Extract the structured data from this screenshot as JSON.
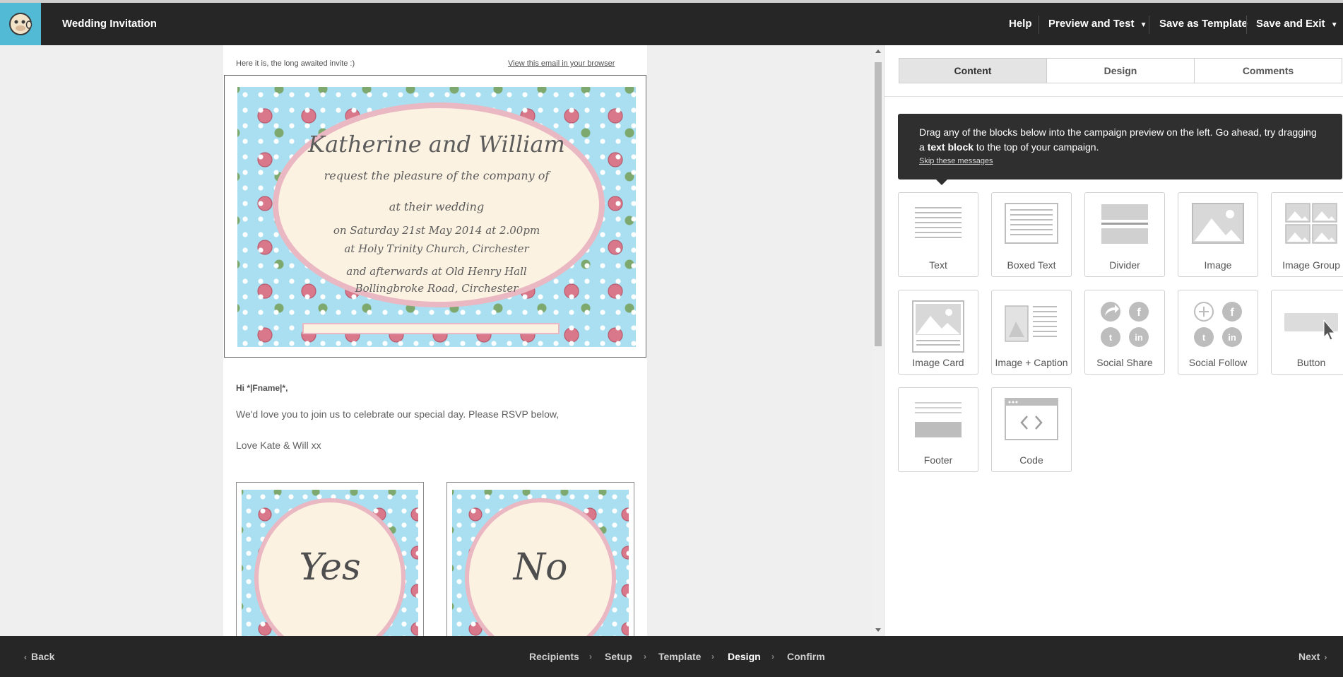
{
  "app": {
    "title": "Wedding Invitation",
    "logo_icon": "chimp-logo-icon"
  },
  "topbar": {
    "help_label": "Help",
    "preview_label": "Preview and Test",
    "save_template_label": "Save as Template",
    "save_exit_label": "Save and Exit"
  },
  "email": {
    "preheader_text": "Here it is, the long awaited invite :)",
    "view_browser_link": "View this email in your browser",
    "invite": {
      "names": "Katherine and William",
      "line1": "request the pleasure of the company of",
      "line2": "at their wedding",
      "line3": "on Saturday 21st May 2014 at 2.00pm",
      "line4": "at Holy Trinity Church, Circhester",
      "line5": "and afterwards at Old Henry Hall",
      "line6": "Bollingbroke Road, Circhester"
    },
    "greeting": "Hi *|Fname|*,",
    "body_line1": "We'd love you to join us to celebrate our special day. Please RSVP below,",
    "body_line2": "Love Kate & Will xx",
    "rsvp_yes": "Yes",
    "rsvp_no": "No"
  },
  "panel": {
    "tabs": [
      "Content",
      "Design",
      "Comments"
    ],
    "active_tab": "Content",
    "tip_text_1": "Drag any of the blocks below into the campaign preview on the left. Go ahead, try dragging a ",
    "tip_bold": "text block",
    "tip_text_2": " to the top of your campaign.",
    "tip_skip": "Skip these messages",
    "blocks": [
      {
        "label": "Text",
        "icon": "text-block-icon"
      },
      {
        "label": "Boxed Text",
        "icon": "boxed-text-block-icon"
      },
      {
        "label": "Divider",
        "icon": "divider-block-icon"
      },
      {
        "label": "Image",
        "icon": "image-block-icon"
      },
      {
        "label": "Image Group",
        "icon": "image-group-block-icon"
      },
      {
        "label": "Image Card",
        "icon": "image-card-block-icon"
      },
      {
        "label": "Image + Caption",
        "icon": "image-caption-block-icon"
      },
      {
        "label": "Social Share",
        "icon": "social-share-block-icon"
      },
      {
        "label": "Social Follow",
        "icon": "social-follow-block-icon"
      },
      {
        "label": "Button",
        "icon": "button-block-icon"
      },
      {
        "label": "Footer",
        "icon": "footer-block-icon"
      },
      {
        "label": "Code",
        "icon": "code-block-icon"
      }
    ]
  },
  "bottombar": {
    "back_label": "Back",
    "next_label": "Next",
    "steps": [
      "Recipients",
      "Setup",
      "Template",
      "Design",
      "Confirm"
    ],
    "active_step": "Design"
  },
  "colors": {
    "accent": "#52bad5",
    "bar_bg": "#262626",
    "tip_bg": "#2f2f2f",
    "card_blue": "#a9dff0",
    "oval_fill": "#fcf2e2",
    "oval_border": "#eab8c2"
  }
}
